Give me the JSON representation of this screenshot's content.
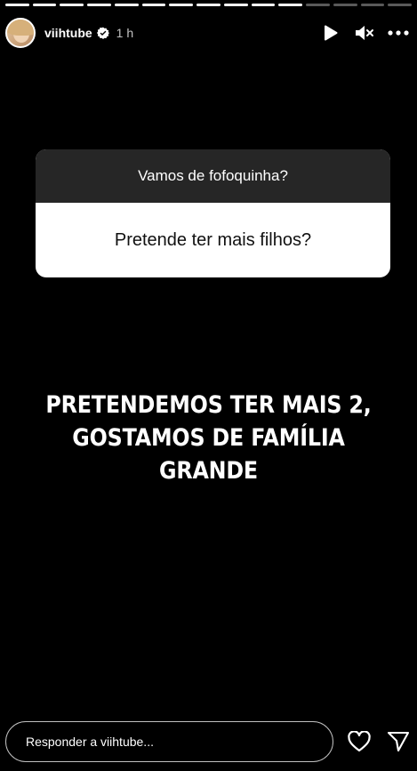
{
  "story": {
    "segments_total": 15,
    "segments_done": 11
  },
  "header": {
    "username": "viihtube",
    "time": "1 h",
    "icons": [
      "play-icon",
      "mute-icon",
      "more-icon"
    ]
  },
  "question_card": {
    "question": "Vamos de fofoquinha?",
    "answer": "Pretende ter mais filhos?"
  },
  "response_text": {
    "line1": "PRETENDEMOS TER MAIS 2,",
    "line2": "GOSTAMOS DE FAMÍLIA",
    "line3": "GRANDE"
  },
  "reply": {
    "placeholder": "Responder a viihtube..."
  },
  "colors": {
    "background": "#000000",
    "card_header": "#262626",
    "verified": "#ffffff"
  }
}
